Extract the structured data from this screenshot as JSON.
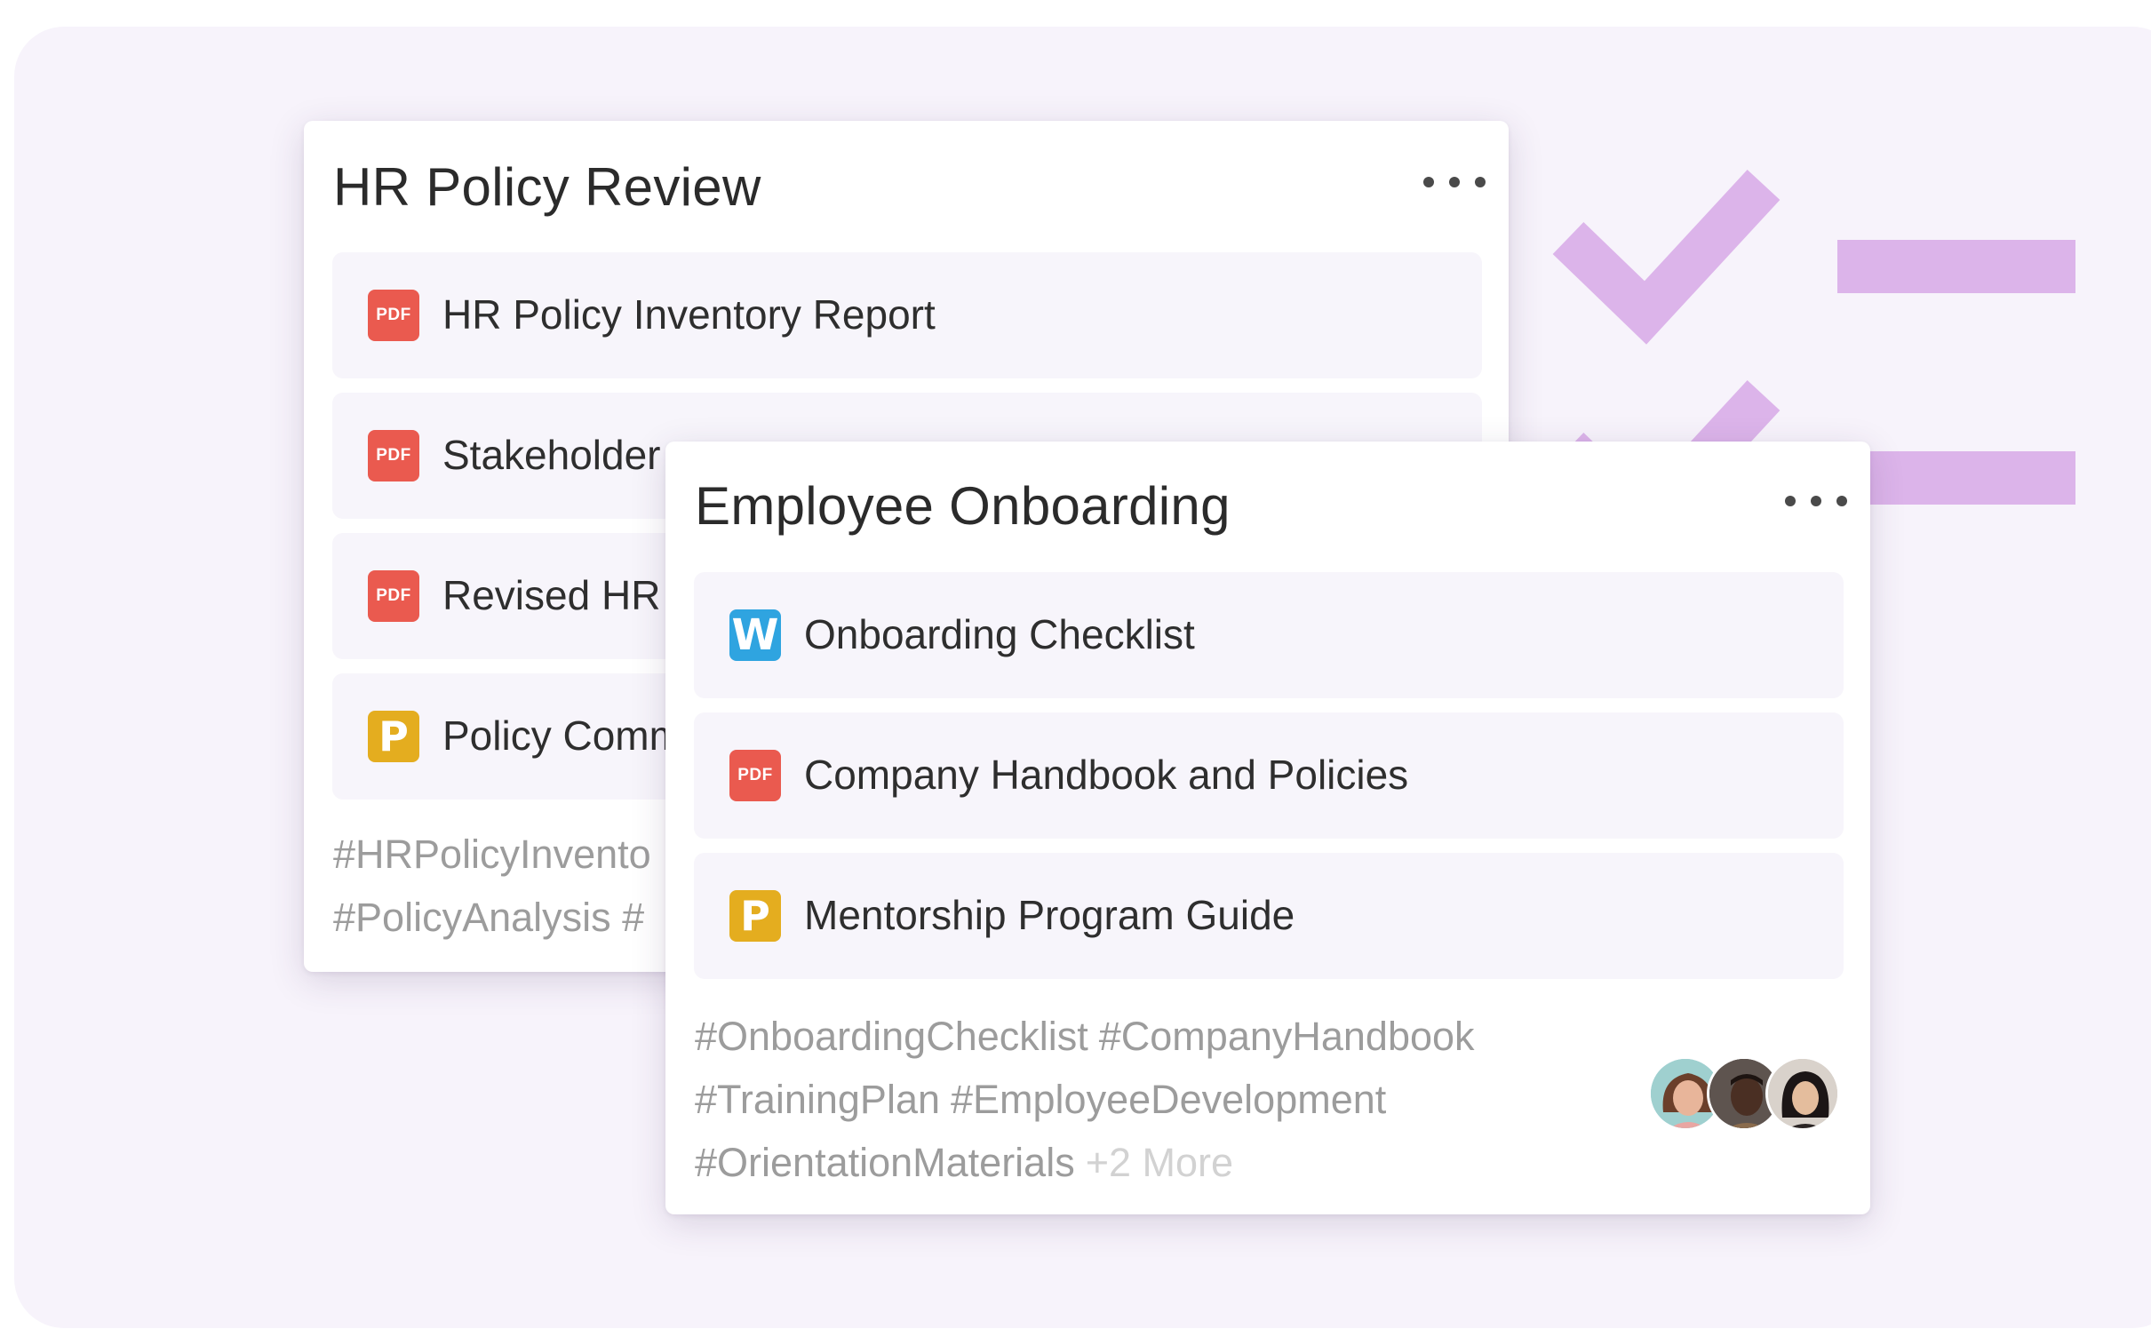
{
  "cards": {
    "back": {
      "title": "HR Policy Review",
      "files": [
        {
          "label": "HR Policy Inventory Report",
          "type": "pdf",
          "icon_text": "PDF"
        },
        {
          "label": "Stakeholder",
          "type": "pdf",
          "icon_text": "PDF"
        },
        {
          "label": "Revised HR",
          "type": "pdf",
          "icon_text": "PDF"
        },
        {
          "label": "Policy Comm",
          "type": "ppt",
          "icon_text": "P"
        }
      ],
      "tags_line1": "#HRPolicyInvento",
      "tags_line2": "#PolicyAnalysis #"
    },
    "front": {
      "title": "Employee Onboarding",
      "files": [
        {
          "label": "Onboarding Checklist",
          "type": "word",
          "icon_text": "W"
        },
        {
          "label": "Company Handbook and Policies",
          "type": "pdf",
          "icon_text": "PDF"
        },
        {
          "label": "Mentorship Program Guide",
          "type": "ppt",
          "icon_text": "P"
        }
      ],
      "tags": [
        "#OnboardingChecklist",
        "#CompanyHandbook",
        "#TrainingPlan",
        "#EmployeeDevelopment",
        "#OrientationMaterials"
      ],
      "more_tags": "+2 More"
    }
  },
  "colors": {
    "background": "#f7f3fb",
    "decor": "#dcb4ea",
    "pdf": "#ea5a4f",
    "word": "#2fa4e0",
    "ppt": "#e4ad1f",
    "tag_text": "#9c9c9c"
  },
  "icons": [
    "more-dots-icon",
    "pdf-file-icon",
    "word-file-icon",
    "powerpoint-file-icon",
    "check-mark-icon"
  ]
}
